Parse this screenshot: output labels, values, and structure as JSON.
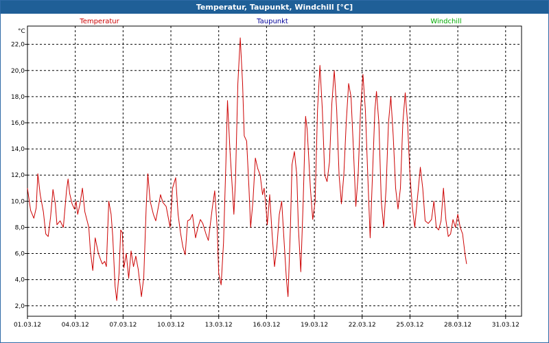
{
  "window": {
    "title": "Temperatur, Taupunkt, Windchill [°C]"
  },
  "colors": {
    "temperatur": "#cc0000",
    "taupunkt": "#000099",
    "windchill": "#00aa00",
    "title_bar": "#1f5f97"
  },
  "chart_data": {
    "type": "line",
    "title": "Temperatur, Taupunkt, Windchill [°C]",
    "ylabel": "°C",
    "xlabel": "",
    "ylim": [
      1.2,
      23.4
    ],
    "xlim": [
      0,
      31
    ],
    "grid": true,
    "legend": "top",
    "yticks": [
      2.0,
      4.0,
      6.0,
      8.0,
      10.0,
      12.0,
      14.0,
      16.0,
      18.0,
      20.0,
      22.0
    ],
    "ytick_labels": [
      "2,0",
      "4,0",
      "6,0",
      "8,0",
      "10,0",
      "12,0",
      "14,0",
      "16,0",
      "18,0",
      "20,0",
      "22,0"
    ],
    "xtick_days": [
      0,
      3,
      6,
      9,
      12,
      15,
      18,
      21,
      24,
      27,
      30
    ],
    "xtick_labels": [
      "01.03.12",
      "04.03.12",
      "07.03.12",
      "10.03.12",
      "13.03.12",
      "16.03.12",
      "19.03.12",
      "22.03.12",
      "25.03.12",
      "28.03.12",
      "31.03.12"
    ],
    "series": [
      {
        "name": "Temperatur",
        "points": [
          [
            0.0,
            11.0
          ],
          [
            0.2,
            9.3
          ],
          [
            0.4,
            8.7
          ],
          [
            0.55,
            9.5
          ],
          [
            0.65,
            12.1
          ],
          [
            0.8,
            10.5
          ],
          [
            1.0,
            9.2
          ],
          [
            1.15,
            7.5
          ],
          [
            1.3,
            7.3
          ],
          [
            1.45,
            8.8
          ],
          [
            1.6,
            10.9
          ],
          [
            1.75,
            9.8
          ],
          [
            1.85,
            8.2
          ],
          [
            2.05,
            8.5
          ],
          [
            2.25,
            8.0
          ],
          [
            2.45,
            10.8
          ],
          [
            2.55,
            11.7
          ],
          [
            2.65,
            10.6
          ],
          [
            2.8,
            9.8
          ],
          [
            2.95,
            9.4
          ],
          [
            3.05,
            10.0
          ],
          [
            3.15,
            9.0
          ],
          [
            3.3,
            9.8
          ],
          [
            3.45,
            11.0
          ],
          [
            3.6,
            9.2
          ],
          [
            3.85,
            8.0
          ],
          [
            3.95,
            6.2
          ],
          [
            4.1,
            4.7
          ],
          [
            4.25,
            7.2
          ],
          [
            4.45,
            6.0
          ],
          [
            4.6,
            5.5
          ],
          [
            4.7,
            5.2
          ],
          [
            4.85,
            5.4
          ],
          [
            4.95,
            5.0
          ],
          [
            5.1,
            10.0
          ],
          [
            5.25,
            9.0
          ],
          [
            5.35,
            7.3
          ],
          [
            5.5,
            3.5
          ],
          [
            5.6,
            2.4
          ],
          [
            5.75,
            4.5
          ],
          [
            5.85,
            7.8
          ],
          [
            5.95,
            7.6
          ],
          [
            6.05,
            4.9
          ],
          [
            6.2,
            6.0
          ],
          [
            6.35,
            4.1
          ],
          [
            6.5,
            6.2
          ],
          [
            6.65,
            5.0
          ],
          [
            6.8,
            5.8
          ],
          [
            6.95,
            4.8
          ],
          [
            7.15,
            2.7
          ],
          [
            7.3,
            4.2
          ],
          [
            7.45,
            9.5
          ],
          [
            7.55,
            12.1
          ],
          [
            7.7,
            10.0
          ],
          [
            7.9,
            9.0
          ],
          [
            8.05,
            8.5
          ],
          [
            8.25,
            9.8
          ],
          [
            8.35,
            10.5
          ],
          [
            8.5,
            9.9
          ],
          [
            8.7,
            9.6
          ],
          [
            8.95,
            8.0
          ],
          [
            9.1,
            11.0
          ],
          [
            9.3,
            11.8
          ],
          [
            9.45,
            9.0
          ],
          [
            9.6,
            7.6
          ],
          [
            9.75,
            6.5
          ],
          [
            9.9,
            5.9
          ],
          [
            10.05,
            8.5
          ],
          [
            10.2,
            8.6
          ],
          [
            10.35,
            9.0
          ],
          [
            10.55,
            7.2
          ],
          [
            10.7,
            8.0
          ],
          [
            10.85,
            8.6
          ],
          [
            11.0,
            8.3
          ],
          [
            11.2,
            7.5
          ],
          [
            11.35,
            7.0
          ],
          [
            11.6,
            9.5
          ],
          [
            11.75,
            10.8
          ],
          [
            11.9,
            8.0
          ],
          [
            12.0,
            4.5
          ],
          [
            12.15,
            3.6
          ],
          [
            12.3,
            6.8
          ],
          [
            12.45,
            13.0
          ],
          [
            12.55,
            17.7
          ],
          [
            12.7,
            14.0
          ],
          [
            12.85,
            11.0
          ],
          [
            12.95,
            9.0
          ],
          [
            13.05,
            11.5
          ],
          [
            13.2,
            19.0
          ],
          [
            13.35,
            22.5
          ],
          [
            13.5,
            19.0
          ],
          [
            13.6,
            15.0
          ],
          [
            13.75,
            14.6
          ],
          [
            13.9,
            11.0
          ],
          [
            14.0,
            8.0
          ],
          [
            14.15,
            10.0
          ],
          [
            14.3,
            13.3
          ],
          [
            14.45,
            12.5
          ],
          [
            14.6,
            12.0
          ],
          [
            14.75,
            10.5
          ],
          [
            14.85,
            11.0
          ],
          [
            14.95,
            9.8
          ],
          [
            15.05,
            8.2
          ],
          [
            15.2,
            10.5
          ],
          [
            15.35,
            7.5
          ],
          [
            15.5,
            5.0
          ],
          [
            15.65,
            6.5
          ],
          [
            15.8,
            9.0
          ],
          [
            15.95,
            10.0
          ],
          [
            16.1,
            7.0
          ],
          [
            16.25,
            4.0
          ],
          [
            16.35,
            2.7
          ],
          [
            16.5,
            8.0
          ],
          [
            16.6,
            12.8
          ],
          [
            16.75,
            13.8
          ],
          [
            16.9,
            12.0
          ],
          [
            17.0,
            8.0
          ],
          [
            17.15,
            4.6
          ],
          [
            17.3,
            10.0
          ],
          [
            17.45,
            16.5
          ],
          [
            17.55,
            15.5
          ],
          [
            17.75,
            11.0
          ],
          [
            17.9,
            8.6
          ],
          [
            18.05,
            10.0
          ],
          [
            18.2,
            17.0
          ],
          [
            18.35,
            20.4
          ],
          [
            18.5,
            17.0
          ],
          [
            18.65,
            12.0
          ],
          [
            18.8,
            11.5
          ],
          [
            18.95,
            13.0
          ],
          [
            19.1,
            17.5
          ],
          [
            19.25,
            20.0
          ],
          [
            19.4,
            17.0
          ],
          [
            19.55,
            12.0
          ],
          [
            19.7,
            9.8
          ],
          [
            19.85,
            12.0
          ],
          [
            20.0,
            16.0
          ],
          [
            20.15,
            19.0
          ],
          [
            20.3,
            18.0
          ],
          [
            20.45,
            14.0
          ],
          [
            20.6,
            9.6
          ],
          [
            20.75,
            12.0
          ],
          [
            20.9,
            17.0
          ],
          [
            21.05,
            19.7
          ],
          [
            21.2,
            17.0
          ],
          [
            21.35,
            12.0
          ],
          [
            21.5,
            7.2
          ],
          [
            21.65,
            12.0
          ],
          [
            21.8,
            17.0
          ],
          [
            21.9,
            18.4
          ],
          [
            22.05,
            16.0
          ],
          [
            22.2,
            10.0
          ],
          [
            22.35,
            8.0
          ],
          [
            22.5,
            11.0
          ],
          [
            22.65,
            16.0
          ],
          [
            22.8,
            18.0
          ],
          [
            22.95,
            15.0
          ],
          [
            23.1,
            11.0
          ],
          [
            23.25,
            9.4
          ],
          [
            23.4,
            11.0
          ],
          [
            23.55,
            16.0
          ],
          [
            23.7,
            18.3
          ],
          [
            23.85,
            16.0
          ],
          [
            24.0,
            12.0
          ],
          [
            24.15,
            9.5
          ],
          [
            24.3,
            8.0
          ],
          [
            24.45,
            10.0
          ],
          [
            24.65,
            12.6
          ],
          [
            24.8,
            11.0
          ],
          [
            24.95,
            8.5
          ],
          [
            25.15,
            8.3
          ],
          [
            25.35,
            8.6
          ],
          [
            25.5,
            10.0
          ],
          [
            25.65,
            8.0
          ],
          [
            25.8,
            7.8
          ],
          [
            25.95,
            8.5
          ],
          [
            26.1,
            11.0
          ],
          [
            26.25,
            8.6
          ],
          [
            26.4,
            7.3
          ],
          [
            26.55,
            7.5
          ],
          [
            26.7,
            8.6
          ],
          [
            26.85,
            8.0
          ],
          [
            27.0,
            9.0
          ],
          [
            27.15,
            8.0
          ],
          [
            27.3,
            7.5
          ],
          [
            27.45,
            6.0
          ],
          [
            27.55,
            5.2
          ]
        ]
      }
    ],
    "legend_entries": [
      "Temperatur",
      "Taupunkt",
      "Windchill"
    ]
  }
}
